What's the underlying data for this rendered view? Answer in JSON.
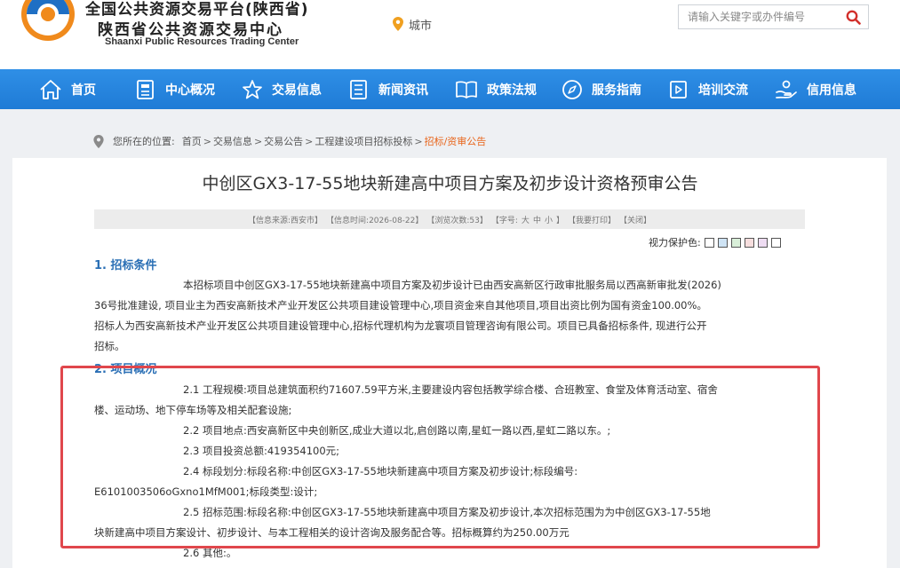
{
  "header": {
    "title_line1": "全国公共资源交易平台(陕西省)",
    "title_line2": "陕西省公共资源交易中心",
    "title_en": "Shaanxi Public Resources Trading Center",
    "city_label": "城市",
    "search": {
      "placeholder": "请输入关键字或办件编号"
    },
    "colors": {
      "logo_blue": "#1f6fc4",
      "logo_orange": "#f08a1c"
    }
  },
  "nav": {
    "items": [
      {
        "label": "首页",
        "icon": "home-icon"
      },
      {
        "label": "中心概况",
        "icon": "document-icon"
      },
      {
        "label": "交易信息",
        "icon": "star-icon"
      },
      {
        "label": "新闻资讯",
        "icon": "news-icon"
      },
      {
        "label": "政策法规",
        "icon": "book-icon"
      },
      {
        "label": "服务指南",
        "icon": "compass-icon"
      },
      {
        "label": "培训交流",
        "icon": "video-icon"
      },
      {
        "label": "信用信息",
        "icon": "hand-icon"
      }
    ],
    "color": "#2486e0"
  },
  "breadcrumb": {
    "prefix": "您所在的位置:",
    "items": [
      "首页",
      "交易信息",
      "交易公告",
      "工程建设项目招标投标",
      "招标/资审公告"
    ],
    "separator": ">"
  },
  "article": {
    "title": "中创区GX3-17-55地块新建高中项目方案及初步设计资格预审公告",
    "info": {
      "source": "【信息来源:西安市】",
      "time": "【信息时间:2026-08-22】",
      "views": "【浏览次数:53】",
      "font_label": "【字号:",
      "font_large": "大",
      "font_medium": "中",
      "font_small": "小",
      "font_end": "】",
      "print": "【我要打印】",
      "close": "【关闭】"
    },
    "vision_label": "视力保护色:",
    "vision_colors": [
      "#ffffff",
      "#cfe4f5",
      "#d9efd9",
      "#f7dede",
      "#eedcf2",
      "#ffffff"
    ],
    "sections": [
      {
        "title": "1. 招标条件",
        "lines": [
          "本招标项目中创区GX3-17-55地块新建高中项目方案及初步设计已由西安高新区行政审批服务局以西高新审批发(2026)",
          "36号批准建设, 项目业主为西安高新技术产业开发区公共项目建设管理中心,项目资金来自其他项目,项目出资比例为国有资金100.00%。",
          "招标人为西安高新技术产业开发区公共项目建设管理中心,招标代理机构为龙寰项目管理咨询有限公司。项目已具备招标条件, 现进行公开",
          "招标。"
        ]
      },
      {
        "title": "2. 项目概况",
        "lines": [
          "2.1 工程规模:项目总建筑面积约71607.59平方米,主要建设内容包括教学综合楼、合班教室、食堂及体育活动室、宿舍",
          "楼、运动场、地下停车场等及相关配套设施;",
          "2.2 项目地点:西安高新区中央创新区,成业大道以北,启创路以南,星虹一路以西,星虹二路以东。;",
          "2.3 项目投资总额:419354100元;",
          "2.4 标段划分:标段名称:中创区GX3-17-55地块新建高中项目方案及初步设计;标段编号:",
          "E6101003506oGxno1MfM001;标段类型:设计;",
          "2.5 招标范围:标段名称:中创区GX3-17-55地块新建高中项目方案及初步设计,本次招标范围为为中创区GX3-17-55地",
          "块新建高中项目方案设计、初步设计、与本工程相关的设计咨询及服务配合等。招标概算约为250.00万元",
          "2.6 其他:。"
        ]
      }
    ]
  }
}
